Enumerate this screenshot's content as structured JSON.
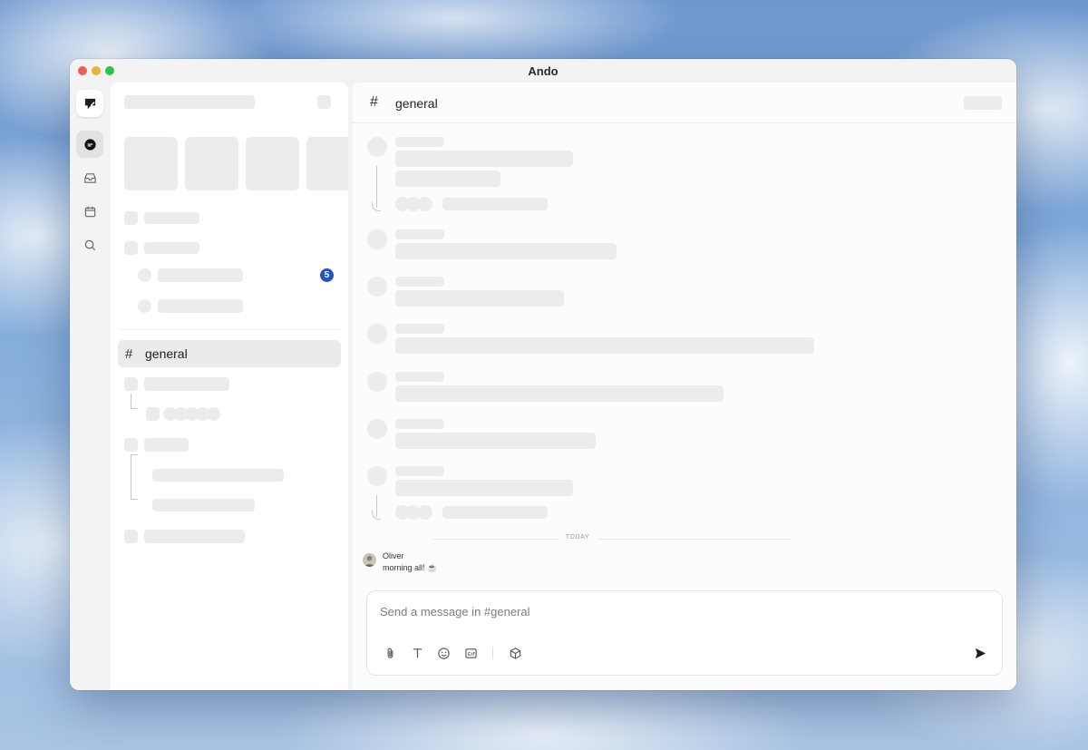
{
  "window": {
    "title": "Ando"
  },
  "rail": {
    "items": [
      {
        "name": "logo",
        "icon": "app-logo-icon"
      },
      {
        "name": "messages",
        "icon": "chat-bubble-icon",
        "active": true
      },
      {
        "name": "inbox",
        "icon": "inbox-icon"
      },
      {
        "name": "calendar",
        "icon": "calendar-icon"
      },
      {
        "name": "search",
        "icon": "search-icon"
      }
    ]
  },
  "sidebar": {
    "unread_badge": "5",
    "active_channel": {
      "hash": "#",
      "label": "general"
    }
  },
  "channel": {
    "hash": "#",
    "name": "general"
  },
  "messages": {
    "divider": "TODAY",
    "latest": {
      "author": "Oliver",
      "text": "morning all! ☕"
    }
  },
  "composer": {
    "placeholder": "Send a message in #general",
    "tools": [
      "paperclip-icon",
      "text-format-icon",
      "emoji-icon",
      "gif-icon",
      "cube-icon"
    ],
    "send_icon": "send-icon"
  },
  "colors": {
    "badge": "#2353c7",
    "accent": "#2353c7"
  }
}
